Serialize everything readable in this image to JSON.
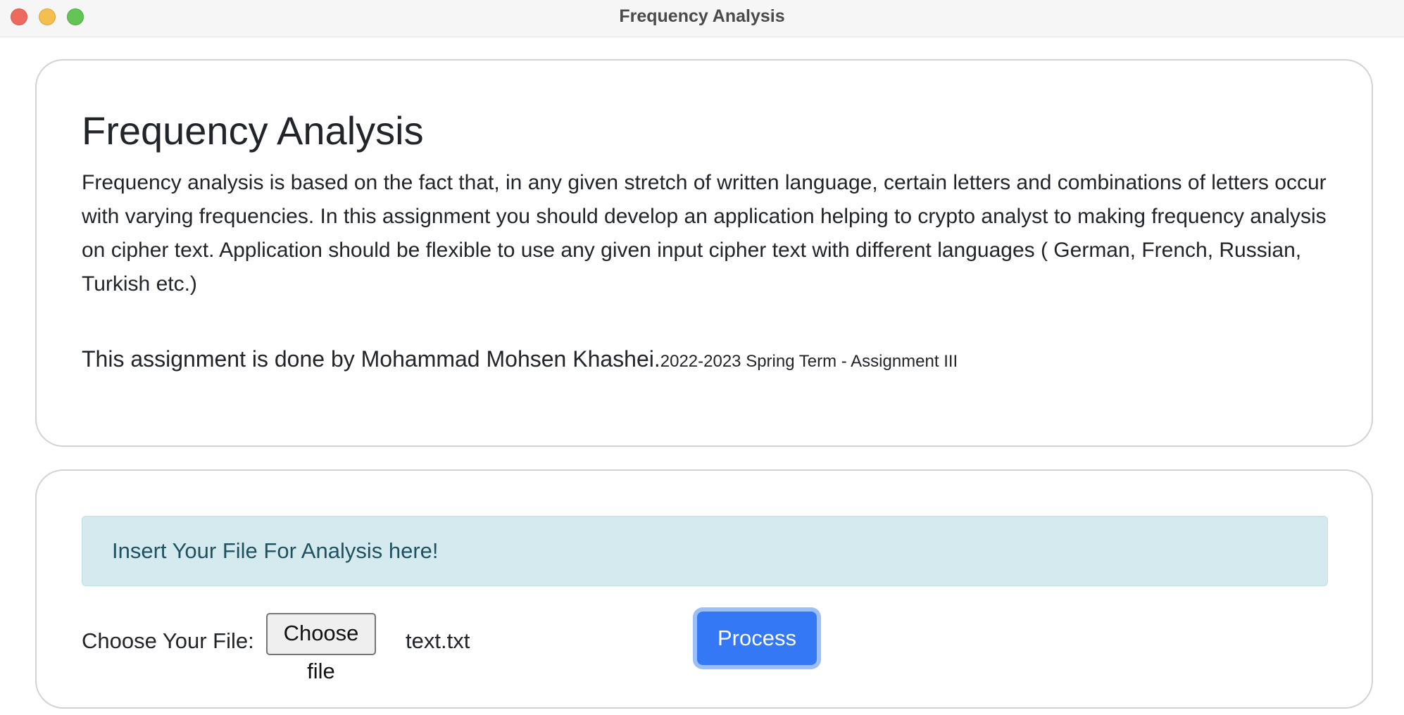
{
  "window": {
    "title": "Frequency Analysis"
  },
  "intro": {
    "heading": "Frequency Analysis",
    "description": "Frequency analysis is based on the fact that, in any given stretch of written language, certain letters and combinations of letters occur with varying frequencies. In this assignment you should develop an application helping to crypto analyst to making frequency analysis on cipher text. Application should be flexible to use any given input cipher text with different languages ( German, French, Russian, Turkish etc.)",
    "credit_main": "This assignment is done by Mohammad Mohsen Khashei.",
    "credit_term": "2022-2023 Spring Term - Assignment III"
  },
  "upload": {
    "alert_text": "Insert Your File For Analysis here!",
    "file_label": "Choose Your File:",
    "choose_file_label": "Choose file",
    "selected_file": "text.txt",
    "process_label": "Process"
  },
  "colors": {
    "alert_background": "#d5eaef",
    "alert_text": "#1f5260",
    "primary_button": "#3478f6",
    "primary_button_focus_ring": "#9dbff8"
  },
  "icons": {
    "close": "close-traffic-light-icon",
    "minimize": "minimize-traffic-light-icon",
    "zoom": "zoom-traffic-light-icon"
  }
}
